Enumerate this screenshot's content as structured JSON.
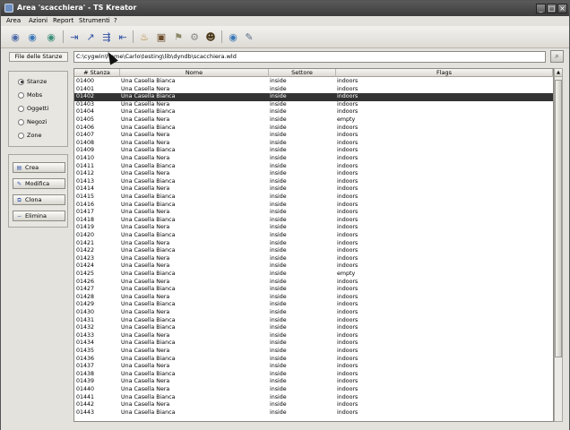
{
  "window": {
    "title": "Area 'scacchiera' - TS Kreator"
  },
  "menu": [
    "Area",
    "Azioni",
    "Report",
    "Strumenti",
    "?"
  ],
  "toolbar": {
    "icons": [
      "globe-icon",
      "globe-icon",
      "globe-icon",
      "arrow-in-icon",
      "arrow-up-icon",
      "arrow-branch-icon",
      "arrow-out-icon",
      "pot-icon",
      "chest-icon",
      "flag-icon",
      "gear-icon",
      "person-icon",
      "globe-icon",
      "tools-icon"
    ]
  },
  "file": {
    "label": "File delle Stanze",
    "path": "C:\\cygwin\\home\\Carlo\\testing\\lib\\dyndb\\scacchiera.wld"
  },
  "categories": {
    "items": [
      "Stanze",
      "Mobs",
      "Oggetti",
      "Negozi",
      "Zone"
    ],
    "selected": "Stanze"
  },
  "actions": {
    "create": "Crea",
    "edit": "Modifica",
    "clone": "Clona",
    "delete": "Elimina"
  },
  "table": {
    "headers": [
      "# Stanza",
      "Nome",
      "Settore",
      "Flags"
    ],
    "selected_id": "01402",
    "rows": [
      [
        "01400",
        "Una Casella Bianca",
        "inside",
        "indoors"
      ],
      [
        "01401",
        "Una Casella Nera",
        "inside",
        "indoors"
      ],
      [
        "01402",
        "Una Casella Bianca",
        "inside",
        "indoors"
      ],
      [
        "01403",
        "Una Casella Nera",
        "inside",
        "indoors"
      ],
      [
        "01404",
        "Una Casella Bianca",
        "inside",
        "indoors"
      ],
      [
        "01405",
        "Una Casella Nera",
        "inside",
        "empty"
      ],
      [
        "01406",
        "Una Casella Bianca",
        "inside",
        "indoors"
      ],
      [
        "01407",
        "Una Casella Nera",
        "inside",
        "indoors"
      ],
      [
        "01408",
        "Una Casella Nera",
        "inside",
        "indoors"
      ],
      [
        "01409",
        "Una Casella Bianca",
        "inside",
        "indoors"
      ],
      [
        "01410",
        "Una Casella Nera",
        "inside",
        "indoors"
      ],
      [
        "01411",
        "Una Casella Bianca",
        "inside",
        "indoors"
      ],
      [
        "01412",
        "Una Casella Nera",
        "inside",
        "indoors"
      ],
      [
        "01413",
        "Una Casella Bianca",
        "inside",
        "indoors"
      ],
      [
        "01414",
        "Una Casella Nera",
        "inside",
        "indoors"
      ],
      [
        "01415",
        "Una Casella Bianca",
        "inside",
        "indoors"
      ],
      [
        "01416",
        "Una Casella Bianca",
        "inside",
        "indoors"
      ],
      [
        "01417",
        "Una Casella Nera",
        "inside",
        "indoors"
      ],
      [
        "01418",
        "Una Casella Bianca",
        "inside",
        "indoors"
      ],
      [
        "01419",
        "Una Casella Nera",
        "inside",
        "indoors"
      ],
      [
        "01420",
        "Una Casella Bianca",
        "inside",
        "indoors"
      ],
      [
        "01421",
        "Una Casella Nera",
        "inside",
        "indoors"
      ],
      [
        "01422",
        "Una Casella Bianca",
        "inside",
        "indoors"
      ],
      [
        "01423",
        "Una Casella Nera",
        "inside",
        "indoors"
      ],
      [
        "01424",
        "Una Casella Nera",
        "inside",
        "indoors"
      ],
      [
        "01425",
        "Una Casella Bianca",
        "inside",
        "empty"
      ],
      [
        "01426",
        "Una Casella Nera",
        "inside",
        "indoors"
      ],
      [
        "01427",
        "Una Casella Bianca",
        "inside",
        "indoors"
      ],
      [
        "01428",
        "Una Casella Nera",
        "inside",
        "indoors"
      ],
      [
        "01429",
        "Una Casella Bianca",
        "inside",
        "indoors"
      ],
      [
        "01430",
        "Una Casella Nera",
        "inside",
        "indoors"
      ],
      [
        "01431",
        "Una Casella Bianca",
        "inside",
        "indoors"
      ],
      [
        "01432",
        "Una Casella Bianca",
        "inside",
        "indoors"
      ],
      [
        "01433",
        "Una Casella Nera",
        "inside",
        "indoors"
      ],
      [
        "01434",
        "Una Casella Bianca",
        "inside",
        "indoors"
      ],
      [
        "01435",
        "Una Casella Nera",
        "inside",
        "indoors"
      ],
      [
        "01436",
        "Una Casella Bianca",
        "inside",
        "indoors"
      ],
      [
        "01437",
        "Una Casella Nera",
        "inside",
        "indoors"
      ],
      [
        "01438",
        "Una Casella Bianca",
        "inside",
        "indoors"
      ],
      [
        "01439",
        "Una Casella Nera",
        "inside",
        "indoors"
      ],
      [
        "01440",
        "Una Casella Nera",
        "inside",
        "indoors"
      ],
      [
        "01441",
        "Una Casella Bianca",
        "inside",
        "indoors"
      ],
      [
        "01442",
        "Una Casella Nera",
        "inside",
        "indoors"
      ],
      [
        "01443",
        "Una Casella Bianca",
        "inside",
        "indoors"
      ]
    ]
  },
  "colors": {
    "titlebar": "#4a4a4a",
    "selection": "#333333",
    "window_bg": "#e4e2dd"
  }
}
